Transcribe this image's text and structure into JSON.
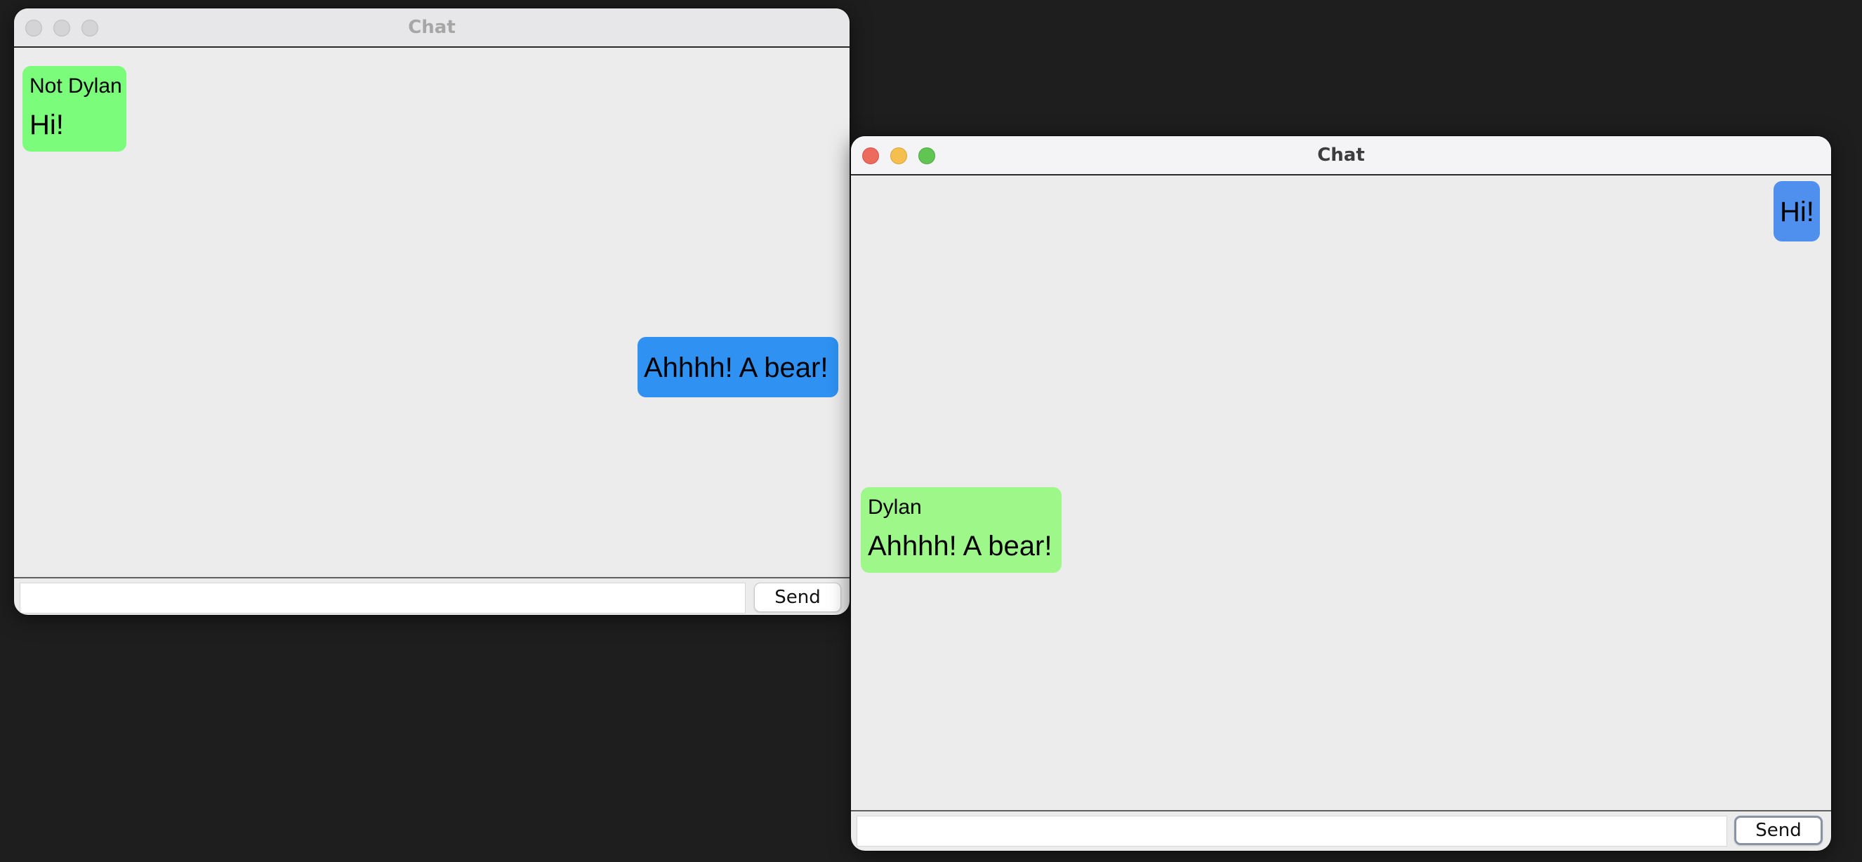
{
  "windows": [
    {
      "title": "Chat",
      "state": "inactive",
      "messages": [
        {
          "sender": "Not Dylan",
          "text": "Hi!",
          "side": "left",
          "color": "#7bfc7b"
        },
        {
          "sender": "",
          "text": "Ahhhh! A bear!",
          "side": "right",
          "color": "#2f91f2"
        }
      ],
      "input": {
        "value": "",
        "placeholder": ""
      },
      "send_label": "Send"
    },
    {
      "title": "Chat",
      "state": "active",
      "messages": [
        {
          "sender": "",
          "text": "Hi!",
          "side": "right",
          "color": "#4f90ee"
        },
        {
          "sender": "Dylan",
          "text": "Ahhhh! A bear!",
          "side": "left",
          "color": "#9ef789"
        }
      ],
      "input": {
        "value": "",
        "placeholder": ""
      },
      "send_label": "Send"
    }
  ],
  "traffic_lights": {
    "close_color": "#ed6a5e",
    "minimize_color": "#f5bf4f",
    "zoom_color": "#61c554",
    "inactive_color": "#d4d4d6"
  }
}
